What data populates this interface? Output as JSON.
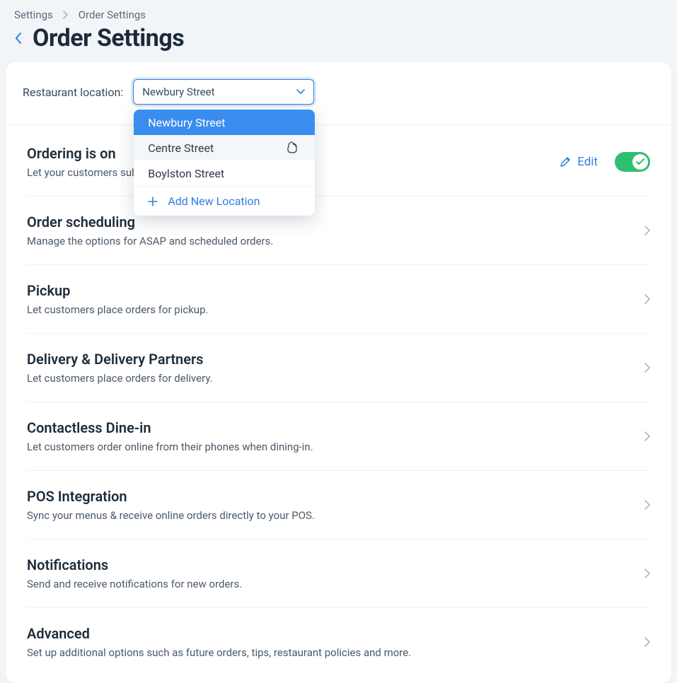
{
  "breadcrumbs": {
    "root": "Settings",
    "current": "Order Settings"
  },
  "page": {
    "title": "Order Settings"
  },
  "location": {
    "label": "Restaurant location:",
    "selected": "Newbury Street",
    "options": [
      "Newbury Street",
      "Centre Street",
      "Boylston Street"
    ],
    "add_label": "Add New Location"
  },
  "ordering": {
    "title": "Ordering is on",
    "subtitle": "Let your customers subm",
    "edit_label": "Edit"
  },
  "sections": [
    {
      "title": "Order scheduling",
      "subtitle": "Manage the options for ASAP and scheduled orders."
    },
    {
      "title": "Pickup",
      "subtitle": "Let customers place orders for pickup."
    },
    {
      "title": "Delivery & Delivery Partners",
      "subtitle": "Let customers place orders for delivery."
    },
    {
      "title": "Contactless Dine-in",
      "subtitle": "Let customers order online from their phones when dining-in."
    },
    {
      "title": "POS Integration",
      "subtitle": "Sync your menus & receive online orders directly to your POS."
    },
    {
      "title": "Notifications",
      "subtitle": "Send and receive notifications for new orders."
    },
    {
      "title": "Advanced",
      "subtitle": "Set up additional options such as future orders, tips, restaurant policies and more."
    }
  ]
}
